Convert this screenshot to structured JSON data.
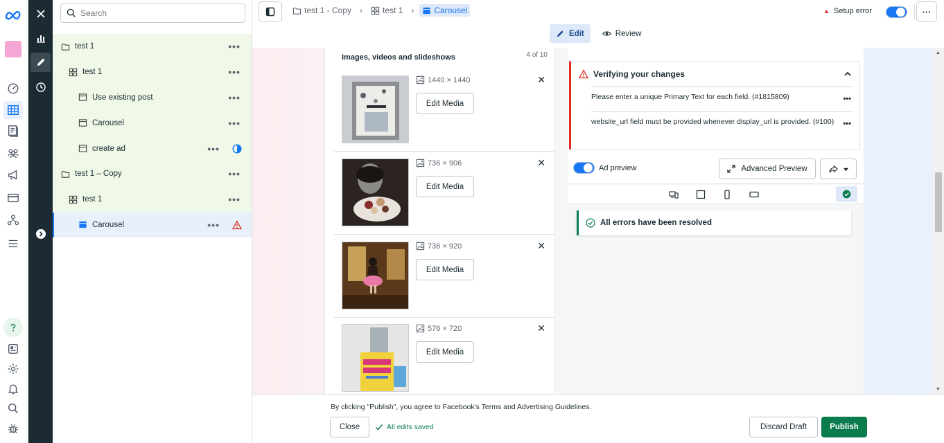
{
  "colors": {
    "accent": "#1877f2",
    "dark_sidebar": "#1c2b33",
    "error": "#d92d20",
    "success": "#0a7b4c"
  },
  "rail": {
    "logo_icon": "meta-logo-icon",
    "items": [
      "dashboard-icon",
      "table-icon",
      "pages-icon",
      "audience-icon",
      "megaphone-icon",
      "billing-icon",
      "accounts-icon",
      "menu-icon"
    ],
    "bottom_items": [
      "help-icon",
      "news-icon",
      "settings-icon",
      "notifications-icon",
      "search-icon",
      "bug-icon"
    ]
  },
  "tree": {
    "search_placeholder": "Search",
    "items": [
      {
        "label": "test 1",
        "type": "campaign"
      },
      {
        "label": "test 1",
        "type": "adset"
      },
      {
        "label": "Use existing post",
        "type": "ad"
      },
      {
        "label": "Carousel",
        "type": "ad"
      },
      {
        "label": "create ad",
        "type": "ad",
        "status": "in-progress"
      },
      {
        "label": "test 1 – Copy",
        "type": "campaign"
      },
      {
        "label": "test 1",
        "type": "adset"
      },
      {
        "label": "Carousel",
        "type": "ad",
        "status": "error"
      }
    ]
  },
  "breadcrumbs": [
    {
      "label": "test 1 - Copy"
    },
    {
      "label": "test 1"
    },
    {
      "label": "Carousel"
    }
  ],
  "top": {
    "setup_error": "Setup error",
    "more": "···"
  },
  "tabs": {
    "edit": "Edit",
    "review": "Review"
  },
  "media": {
    "title": "Images, videos and slideshows",
    "count": "4 of 10",
    "edit_label": "Edit Media",
    "items": [
      {
        "dimensions": "1440 × 1440"
      },
      {
        "dimensions": "736 × 906"
      },
      {
        "dimensions": "736 × 920"
      },
      {
        "dimensions": "576 × 720"
      }
    ]
  },
  "verify": {
    "title": "Verifying your changes",
    "errors": [
      "Please enter a unique Primary Text for each field. (#1815809)",
      "website_url field must be provided whenever display_url is provided. (#100)"
    ]
  },
  "preview": {
    "toggle_label": "Ad preview",
    "advanced_label": "Advanced Preview",
    "resolved": "All errors have been resolved"
  },
  "footer": {
    "agree_text": "By clicking \"Publish\", you agree to Facebook's Terms and Advertising Guidelines.",
    "close": "Close",
    "saved": "All edits saved",
    "discard": "Discard Draft",
    "publish": "Publish"
  }
}
